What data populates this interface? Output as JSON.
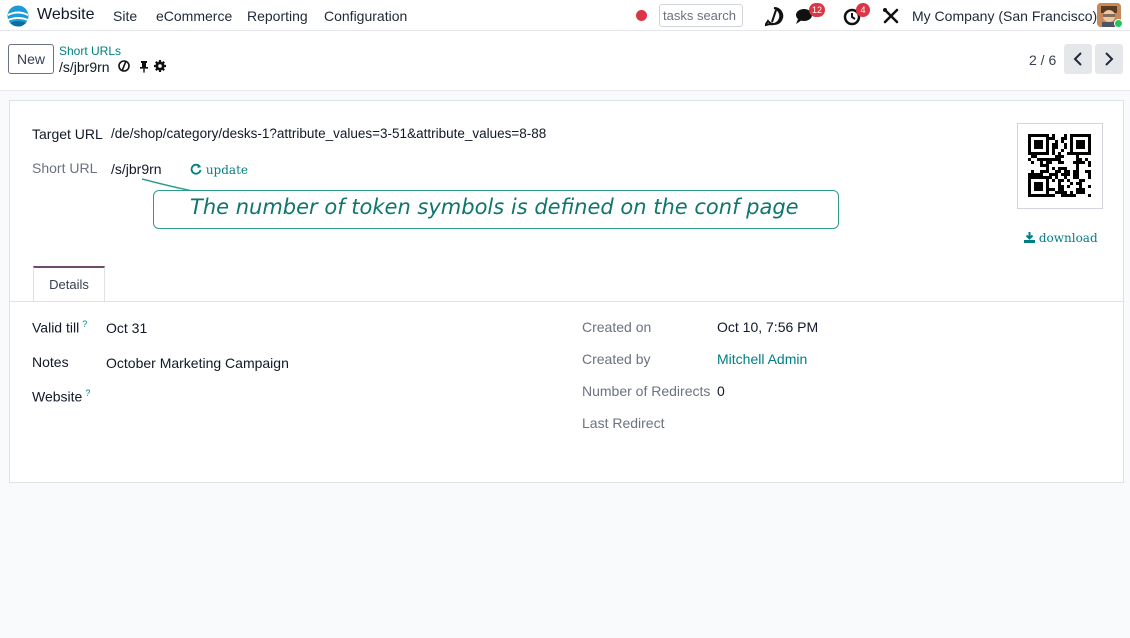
{
  "navbar": {
    "app_name": "Website",
    "menus": [
      "Site",
      "eCommerce",
      "Reporting",
      "Configuration"
    ],
    "search_value": "tasks search",
    "messages_count": "12",
    "activities_count": "4",
    "company": "My Company (San Francisco)"
  },
  "control_panel": {
    "new_label": "New",
    "breadcrumb": "Short URLs",
    "record_name": "/s/jbr9rn",
    "pager": "2 / 6"
  },
  "form": {
    "target_url_label": "Target URL",
    "target_url_value": "/de/shop/category/desks-1?attribute_values=3-51&attribute_values=8-88",
    "short_url_label": "Short URL",
    "short_url_value": "/s/jbr9rn",
    "update_label": "update",
    "download_label": "download",
    "callout_text": "The number of token symbols is defined on the conf page",
    "tab_details": "Details",
    "valid_till_label": "Valid till",
    "valid_till_value": "Oct 31",
    "notes_label": "Notes",
    "notes_value": "October Marketing Campaign",
    "website_label": "Website",
    "help_mark": "?",
    "created_on_label": "Created on",
    "created_on_value": "Oct 10, 7:56 PM",
    "created_by_label": "Created by",
    "created_by_value": "Mitchell Admin",
    "redirects_label": "Number of Redirects",
    "redirects_value": "0",
    "last_redirect_label": "Last Redirect"
  },
  "icons": [
    "website-app-icon",
    "activity-icon",
    "chat-icon",
    "clock-icon",
    "tools-icon",
    "pin-icon",
    "gear-icon",
    "chevron-left-icon",
    "chevron-right-icon",
    "refresh-icon",
    "download-icon",
    "qr-code"
  ],
  "colors": {
    "accent": "#017e84",
    "badge": "#dc3545",
    "tab": "#714b67",
    "callout": "#2e9c8c"
  }
}
